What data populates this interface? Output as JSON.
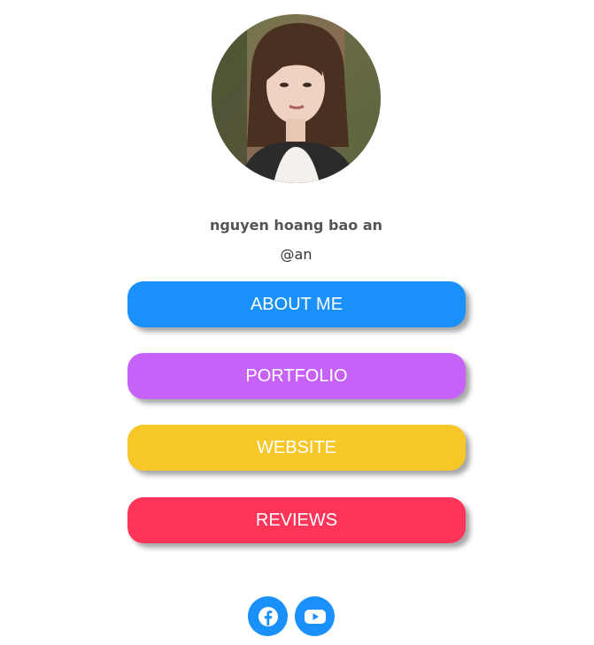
{
  "profile": {
    "name": "nguyen hoang bao an",
    "handle": "@an"
  },
  "links": [
    {
      "label": "ABOUT ME",
      "color": "#1a91fa"
    },
    {
      "label": "PORTFOLIO",
      "color": "#c762f8"
    },
    {
      "label": "WEBSITE",
      "color": "#f7c72a"
    },
    {
      "label": "REVIEWS",
      "color": "#fe3459"
    }
  ],
  "social": [
    {
      "icon": "facebook-icon",
      "color": "#1a91fa"
    },
    {
      "icon": "youtube-icon",
      "color": "#1a91fa"
    }
  ]
}
